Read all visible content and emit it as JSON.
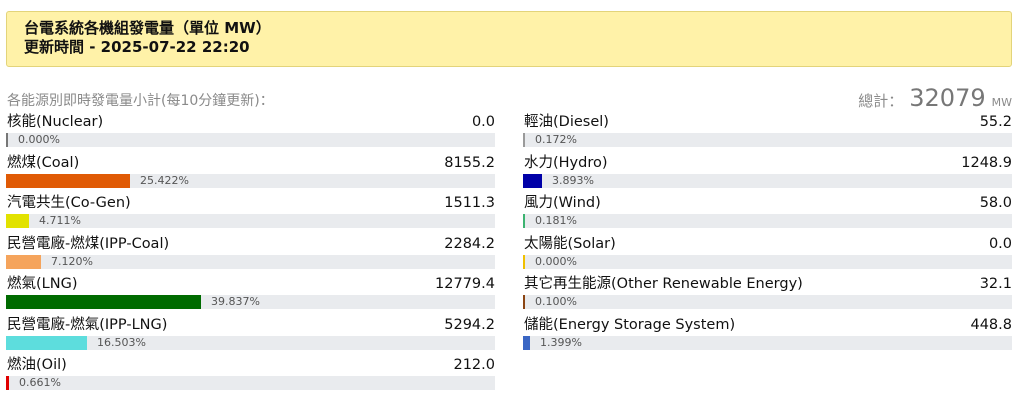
{
  "header": {
    "title": "台電系統各機組發電量（單位 MW）",
    "updated": "更新時間 - 2025-07-22 22:20"
  },
  "subtitle": "各能源別即時發電量小計(每10分鐘更新)：",
  "total": {
    "label": "總計：",
    "value": "32079",
    "unit": "MW"
  },
  "left_sources": [
    {
      "name": "核能(Nuclear)",
      "value": "0.0",
      "percent": "0.000%",
      "fraction": 0.0,
      "color": "#777777"
    },
    {
      "name": "燃煤(Coal)",
      "value": "8155.2",
      "percent": "25.422%",
      "fraction": 0.25422,
      "color": "#e05a05"
    },
    {
      "name": "汽電共生(Co-Gen)",
      "value": "1511.3",
      "percent": "4.711%",
      "fraction": 0.04711,
      "color": "#e2e200"
    },
    {
      "name": "民營電廠-燃煤(IPP-Coal)",
      "value": "2284.2",
      "percent": "7.120%",
      "fraction": 0.0712,
      "color": "#f5a45c"
    },
    {
      "name": "燃氣(LNG)",
      "value": "12779.4",
      "percent": "39.837%",
      "fraction": 0.39837,
      "color": "#006b00"
    },
    {
      "name": "民營電廠-燃氣(IPP-LNG)",
      "value": "5294.2",
      "percent": "16.503%",
      "fraction": 0.16503,
      "color": "#5ddddd"
    },
    {
      "name": "燃油(Oil)",
      "value": "212.0",
      "percent": "0.661%",
      "fraction": 0.00661,
      "color": "#e00000"
    }
  ],
  "right_sources": [
    {
      "name": "輕油(Diesel)",
      "value": "55.2",
      "percent": "0.172%",
      "fraction": 0.00172,
      "color": "#9a9a9a"
    },
    {
      "name": "水力(Hydro)",
      "value": "1248.9",
      "percent": "3.893%",
      "fraction": 0.03893,
      "color": "#0000a8"
    },
    {
      "name": "風力(Wind)",
      "value": "58.0",
      "percent": "0.181%",
      "fraction": 0.00181,
      "color": "#3cb371"
    },
    {
      "name": "太陽能(Solar)",
      "value": "0.0",
      "percent": "0.000%",
      "fraction": 0.0,
      "color": "#f0c000"
    },
    {
      "name": "其它再生能源(Other Renewable Energy)",
      "value": "32.1",
      "percent": "0.100%",
      "fraction": 0.001,
      "color": "#8b4513"
    },
    {
      "name": "儲能(Energy Storage System)",
      "value": "448.8",
      "percent": "1.399%",
      "fraction": 0.01399,
      "color": "#3a66c4"
    }
  ]
}
